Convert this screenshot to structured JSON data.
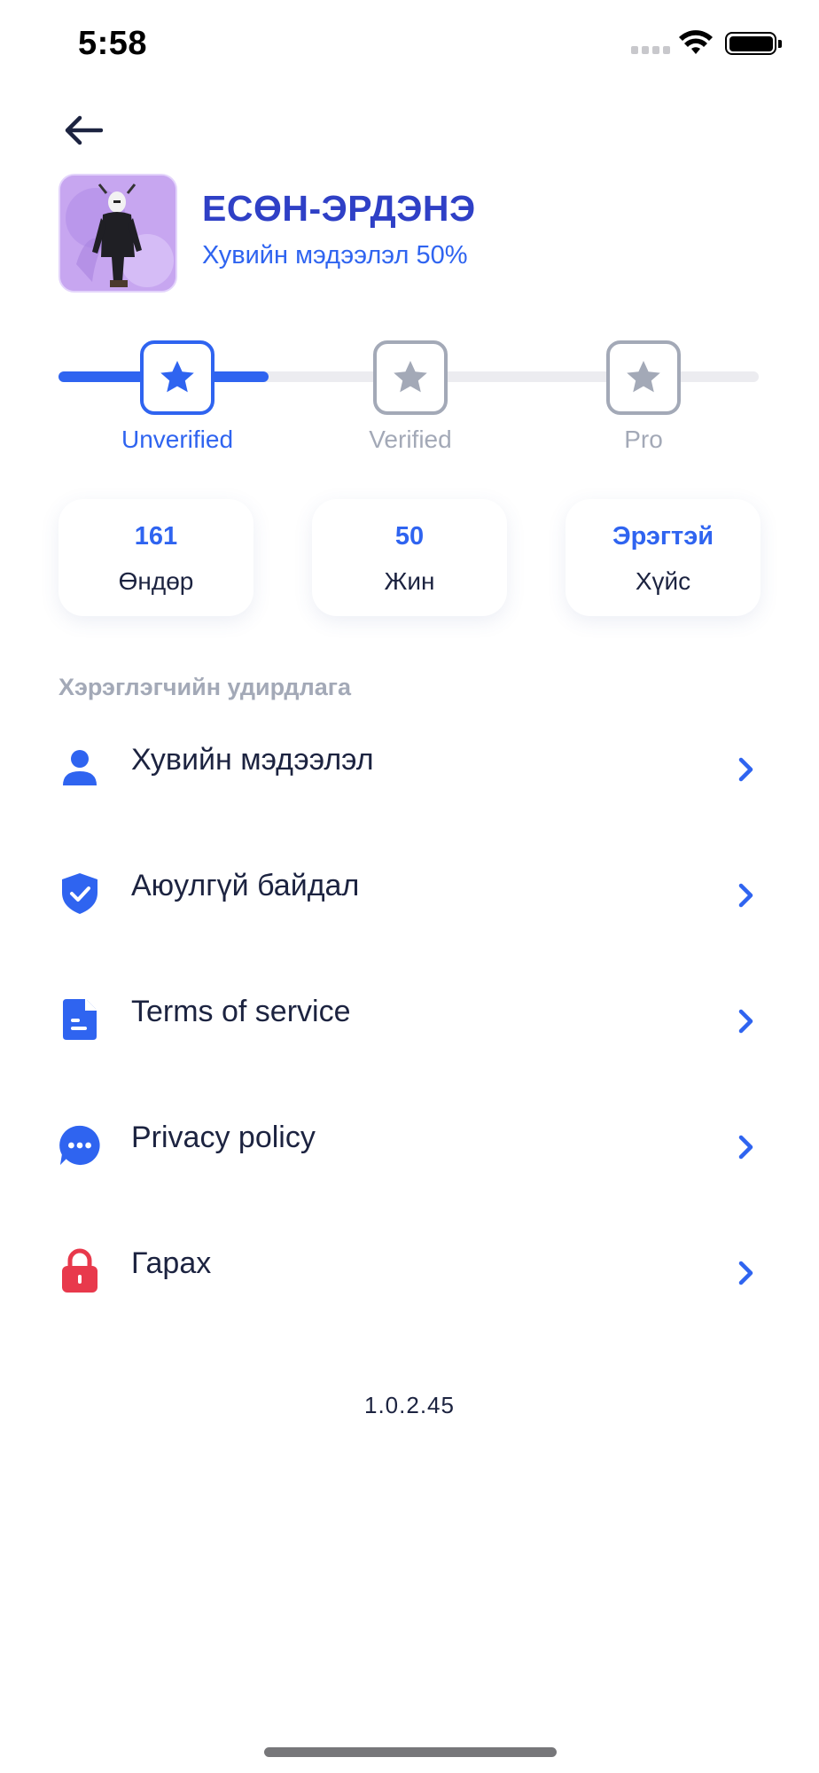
{
  "status_bar": {
    "time": "5:58"
  },
  "profile": {
    "name": "ЕСӨН-ЭРДЭНЭ",
    "completion_text": "Хувийн мэдээлэл 50%"
  },
  "verification": {
    "progress_fraction": 0.3,
    "levels": [
      {
        "label": "Unverified",
        "state": "active"
      },
      {
        "label": "Verified",
        "state": "inactive"
      },
      {
        "label": "Pro",
        "state": "inactive"
      }
    ]
  },
  "stats": [
    {
      "value": "161",
      "label": "Өндөр"
    },
    {
      "value": "50",
      "label": "Жин"
    },
    {
      "value": "Эрэгтэй",
      "label": "Хүйс"
    }
  ],
  "section": {
    "title": "Хэрэглэгчийн удирдлага",
    "items": [
      {
        "label": "Хувийн мэдээлэл",
        "icon": "person-icon"
      },
      {
        "label": "Аюулгүй байдал",
        "icon": "shield-icon"
      },
      {
        "label": "Terms of service",
        "icon": "document-icon"
      },
      {
        "label": "Privacy policy",
        "icon": "chat-icon"
      },
      {
        "label": "Гарах",
        "icon": "lock-icon"
      }
    ]
  },
  "version": "1.0.2.45",
  "colors": {
    "primary": "#2f64f0",
    "name": "#2f40c6",
    "muted": "#a3a9b7",
    "logout": "#e8394c"
  }
}
